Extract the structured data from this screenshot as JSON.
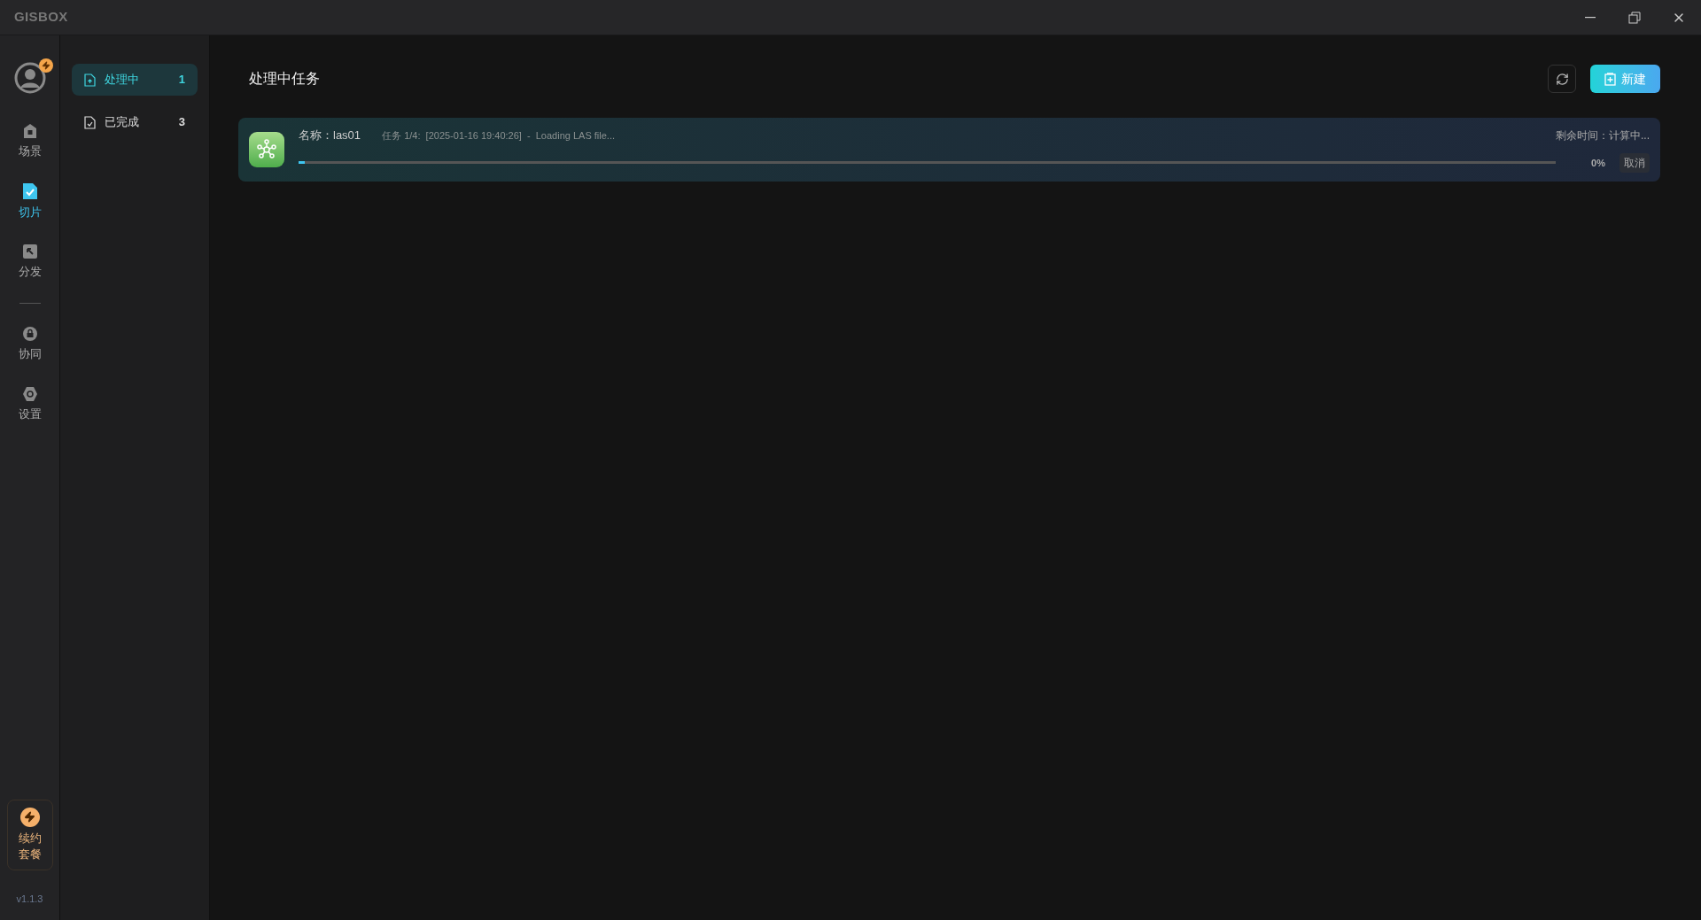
{
  "window": {
    "logo": "GISBOX"
  },
  "rail": {
    "avatar_badge": true,
    "groups": [
      [
        {
          "label": "场景",
          "selected": false
        },
        {
          "label": "切片",
          "selected": true
        },
        {
          "label": "分发",
          "selected": false
        }
      ],
      [
        {
          "label": "协同",
          "selected": false
        },
        {
          "label": "设置",
          "selected": false
        }
      ]
    ],
    "renew": [
      "续约",
      "套餐"
    ],
    "version": "v1.1.3"
  },
  "sidebar": {
    "items": [
      {
        "label": "处理中",
        "count": "1",
        "selected": true
      },
      {
        "label": "已完成",
        "count": "3",
        "selected": false
      }
    ]
  },
  "main": {
    "title": "处理中任务",
    "new_button": "新建",
    "tasks": [
      {
        "name": "名称：las01",
        "step": "任务 1/4:  [2025-01-16 19:40:26]  -  Loading LAS file...",
        "remaining": "剩余时间：计算中...",
        "percent": "0%",
        "level": 0.005,
        "cancel": "取消"
      }
    ]
  }
}
